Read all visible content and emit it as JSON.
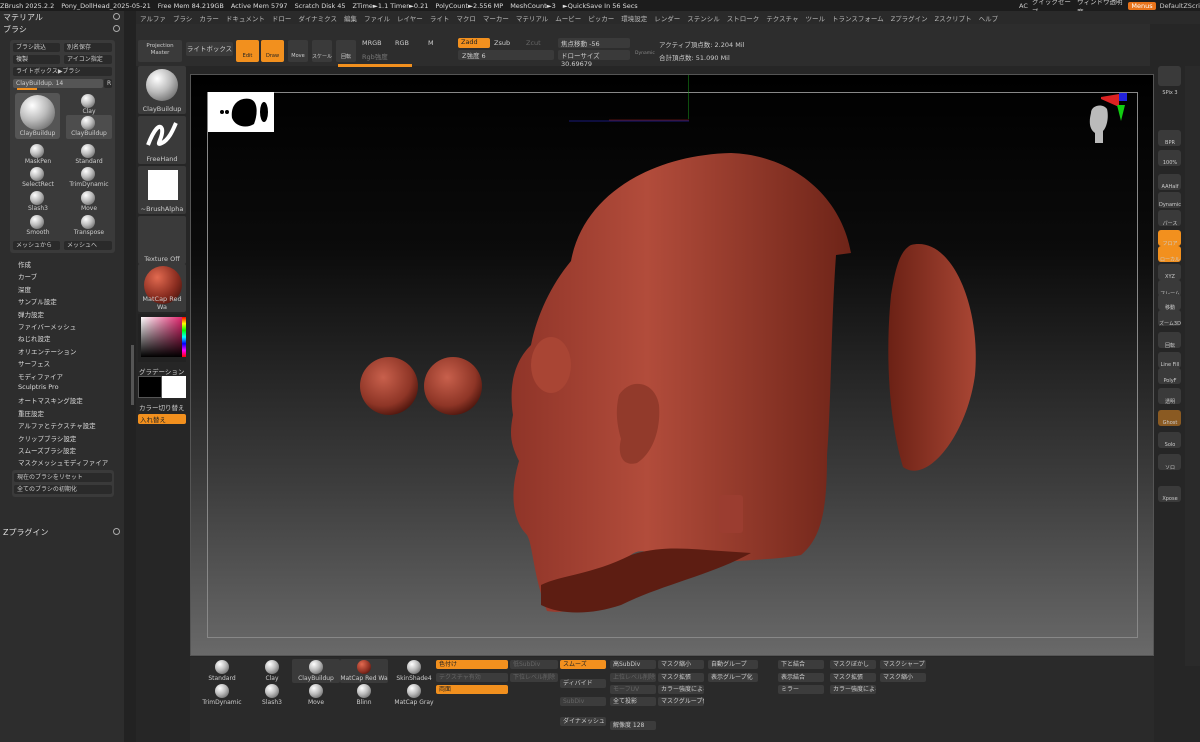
{
  "titlebar": {
    "items": [
      "ZBrush 2025.2.2",
      "Pony_DollHead_2025-05-21",
      "Free Mem 84.219GB",
      "Active Mem 5797",
      "Scratch Disk 45",
      "ZTime►1.1 Timer►0.21",
      "PolyCount►2.556 MP",
      "MeshCount►3",
      "►QuickSave In 56 Secs"
    ],
    "ac": "AC",
    "quicksave": "クイックセーブ",
    "window_opacity": "ウィンドウ透明度",
    "menus": "Menus",
    "layout": "DefaultZScri"
  },
  "menubar": [
    "アルファ",
    "ブラシ",
    "カラー",
    "ドキュメント",
    "ドロー",
    "ダイナミクス",
    "編集",
    "ファイル",
    "レイヤー",
    "ライト",
    "マクロ",
    "マーカー",
    "マテリアル",
    "ムービー",
    "ピッカー",
    "環境設定",
    "レンダー",
    "ステンシル",
    "ストローク",
    "テクスチャ",
    "ツール",
    "トランスフォーム",
    "Zプラグイン",
    "Zスクリプト",
    "ヘルプ"
  ],
  "left": {
    "material": "マテリアル",
    "brush": "ブラシ",
    "buttons": [
      "ブラシ読込",
      "別名保存",
      "複製",
      "アイコン指定",
      "ライトボックス▶ブラシ"
    ],
    "slider_label": "ClayBuildup. 14",
    "r": "R",
    "current": "ClayBuildup",
    "brushes": [
      "Clay",
      "ClayBuildup",
      "MaskPen",
      "Standard",
      "SelectRect",
      "TrimDynamic",
      "Slash3",
      "Move",
      "Smooth",
      "Transpose"
    ],
    "mesh_buttons": [
      "メッシュから",
      "メッシュへ"
    ],
    "submenu": [
      "作成",
      "カーブ",
      "深度",
      "サンプル設定",
      "弾力設定",
      "ファイバーメッシュ",
      "ねじれ設定",
      "オリエンテーション",
      "サーフェス",
      "モディファイア",
      "Sculptris Pro",
      "オートマスキング設定",
      "重圧設定",
      "アルファとテクスチャ設定",
      "クリップブラシ設定",
      "スムーズブラシ設定",
      "マスクメッシュモディファイア"
    ],
    "reset": [
      "現在のブラシをリセット",
      "全てのブラシの初期化"
    ],
    "zplugin": "Zプラグイン"
  },
  "tools": {
    "projection": "Projection Master",
    "lightbox": "ライトボックス",
    "brush": "ClayBuildup",
    "stroke": "FreeHand",
    "alpha": "~BrushAlpha",
    "texture": "Texture Off",
    "material": "MatCap Red Wa",
    "gradient": "グラデーション",
    "swap": "カラー切り替え",
    "replace": "入れ替え"
  },
  "topbar": {
    "edit": "Edit",
    "move": "Move",
    "draw": "Draw",
    "scale": "スケール",
    "rotate": "回転",
    "mrgb": "MRGB",
    "rgb": "RGB",
    "m": "M",
    "rgb_intensity": "Rgb強度",
    "zadd": "Zadd",
    "zsub": "Zsub",
    "zcut": "Zcut",
    "z_intensity": "Z強度 6",
    "focal_shift": "焦点移動 -56",
    "draw_size": "ドローサイズ 30.69679",
    "dynamic": "Dynamic",
    "active_points": "アクティブ頂点数: 2.204 Mil",
    "total_points": "合計頂点数: 51.090 Mil"
  },
  "right": {
    "spix": "SPix 3",
    "labels": [
      "BPR",
      "100%",
      "AAHalf",
      "Dynamic",
      "パース",
      "フロア",
      "ローカル",
      "XYZ",
      "フレーム",
      "移動",
      "ズーム3D",
      "回転",
      "Line Fill",
      "PolyF",
      "透明",
      "Ghost",
      "Solo",
      "ソロ",
      "Xpose"
    ]
  },
  "bottom": {
    "brushes": [
      "Standard",
      "Clay",
      "ClayBuildup",
      "MatCap Red Wa",
      "SkinShade4",
      "TrimDynamic",
      "Slash3",
      "Move",
      "Blinn",
      "MatCap Gray"
    ],
    "col1": [
      "色付け",
      "テクスチャ有効",
      "両面"
    ],
    "col2": [
      "低SubDiv",
      "下位レベル削除"
    ],
    "col3": [
      "スムーズ",
      "ディバイド",
      "SubDiv",
      "ダイナメッシュ"
    ],
    "col4": [
      "高SubDiv",
      "上位レベル削除",
      "モーフUV",
      "全て投影",
      "解像度 128"
    ],
    "col5": [
      "マスク縮小",
      "マスク拡張",
      "カラー強度によるマスク",
      "マスクグループ化"
    ],
    "col6": [
      "自動グループ",
      "表示グループ化"
    ],
    "col7": [
      "下と結合",
      "表示結合",
      "ミラー"
    ],
    "col8": [
      "マスクぼかし",
      "マスク拡張",
      "カラー強度によるマスク"
    ],
    "col9": [
      "マスクシャープ",
      "マスク縮小"
    ]
  },
  "colors": {
    "accent": "#f2901e",
    "clay": "#9b3d30"
  }
}
